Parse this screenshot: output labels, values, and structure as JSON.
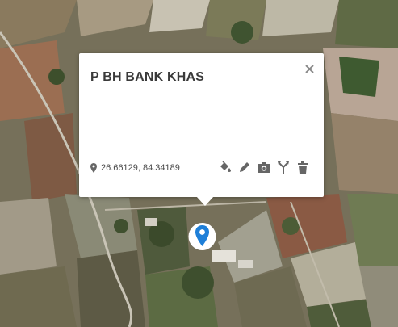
{
  "popup": {
    "title": "P BH BANK KHAS",
    "coordinates": "26.66129, 84.34189"
  },
  "icons": {
    "close": "close-icon",
    "location": "location-pin-icon",
    "fill_color": "paint-bucket-icon",
    "edit": "pencil-icon",
    "photo": "camera-icon",
    "route": "directions-icon",
    "delete": "trash-icon",
    "marker": "map-marker-icon"
  },
  "colors": {
    "marker": "#1e7fd8",
    "title": "#3a3a3a",
    "icon": "#666666"
  }
}
